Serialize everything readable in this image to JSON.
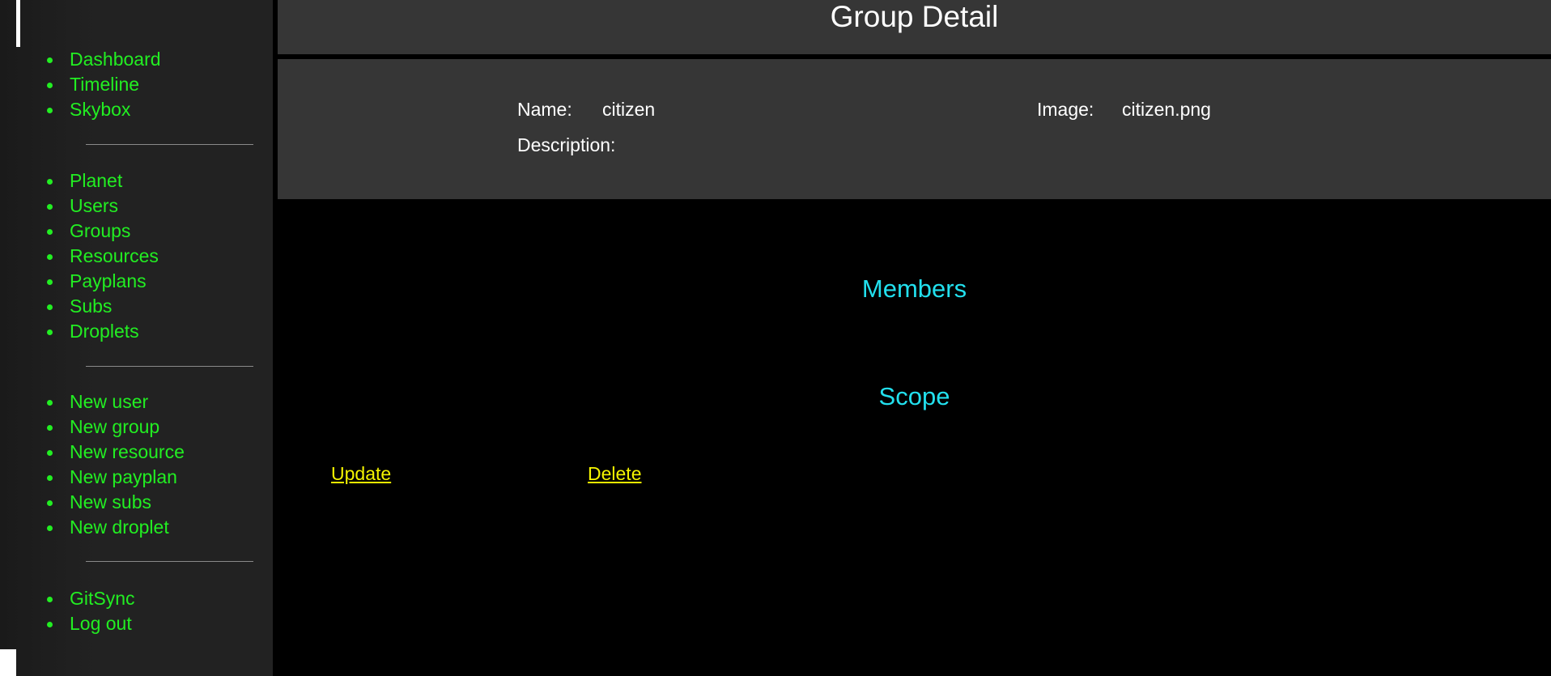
{
  "sidebar": {
    "group1": [
      {
        "label": "Dashboard"
      },
      {
        "label": "Timeline"
      },
      {
        "label": "Skybox"
      }
    ],
    "group2": [
      {
        "label": "Planet"
      },
      {
        "label": "Users"
      },
      {
        "label": "Groups"
      },
      {
        "label": "Resources"
      },
      {
        "label": "Payplans"
      },
      {
        "label": "Subs"
      },
      {
        "label": "Droplets"
      }
    ],
    "group3": [
      {
        "label": "New user"
      },
      {
        "label": "New group"
      },
      {
        "label": "New resource"
      },
      {
        "label": "New payplan"
      },
      {
        "label": "New subs"
      },
      {
        "label": "New droplet"
      }
    ],
    "group4": [
      {
        "label": "GitSync"
      },
      {
        "label": "Log out"
      }
    ]
  },
  "header": {
    "title": "Group Detail"
  },
  "detail": {
    "name_label": "Name:",
    "name_value": "citizen",
    "image_label": "Image:",
    "image_value": "citizen.png",
    "description_label": "Description:",
    "description_value": ""
  },
  "sections": {
    "members": "Members",
    "scope": "Scope"
  },
  "actions": {
    "update": "Update",
    "delete": "Delete"
  },
  "colors": {
    "nav_link": "#22ee22",
    "heading": "#22e0ee",
    "action_link": "#f4f400",
    "panel_bg": "#363636",
    "page_bg": "#000000"
  }
}
